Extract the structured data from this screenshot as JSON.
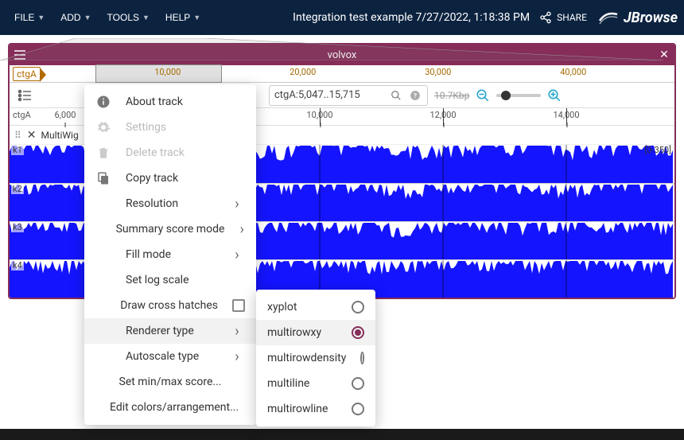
{
  "topbar": {
    "menus": [
      "FILE",
      "ADD",
      "TOOLS",
      "HELP"
    ],
    "session_title": "Integration test example 7/27/2022, 1:18:38 PM",
    "share_label": "SHARE",
    "logo": "JBrowse"
  },
  "view": {
    "title": "volvox",
    "chrom": "ctgA",
    "overview_ticks": [
      "10,000",
      "20,000",
      "30,000",
      "40,000"
    ],
    "location": "ctgA:5,047..15,715",
    "bp_span": "10.7Kbp",
    "scale_ticks": [
      {
        "label": "6,000",
        "pos": 70
      },
      {
        "label": "10,000",
        "pos": 390,
        "major": true
      },
      {
        "label": "12,000",
        "pos": 545,
        "major": true
      },
      {
        "label": "14,000",
        "pos": 700,
        "major": true
      }
    ]
  },
  "track": {
    "name": "MultiWig",
    "range_label": "[0-350]",
    "rows": [
      "k1",
      "k2",
      "k3",
      "k4"
    ]
  },
  "context_menu": {
    "items": [
      {
        "kind": "icon",
        "icon": "info",
        "label": "About track"
      },
      {
        "kind": "icon",
        "icon": "gear",
        "label": "Settings",
        "disabled": true
      },
      {
        "kind": "icon",
        "icon": "trash",
        "label": "Delete track",
        "disabled": true
      },
      {
        "kind": "icon",
        "icon": "copy",
        "label": "Copy track"
      },
      {
        "kind": "sub",
        "label": "Resolution"
      },
      {
        "kind": "sub",
        "label": "Summary score mode"
      },
      {
        "kind": "sub",
        "label": "Fill mode"
      },
      {
        "kind": "plain",
        "label": "Set log scale"
      },
      {
        "kind": "check",
        "label": "Draw cross hatches"
      },
      {
        "kind": "sub",
        "label": "Renderer type",
        "hovered": true
      },
      {
        "kind": "sub",
        "label": "Autoscale type"
      },
      {
        "kind": "plain",
        "label": "Set min/max score..."
      },
      {
        "kind": "plain",
        "label": "Edit colors/arrangement..."
      }
    ]
  },
  "submenu": {
    "items": [
      {
        "label": "xyplot",
        "selected": false
      },
      {
        "label": "multirowxy",
        "selected": true
      },
      {
        "label": "multirowdensity",
        "selected": false
      },
      {
        "label": "multiline",
        "selected": false
      },
      {
        "label": "multirowline",
        "selected": false
      }
    ]
  }
}
